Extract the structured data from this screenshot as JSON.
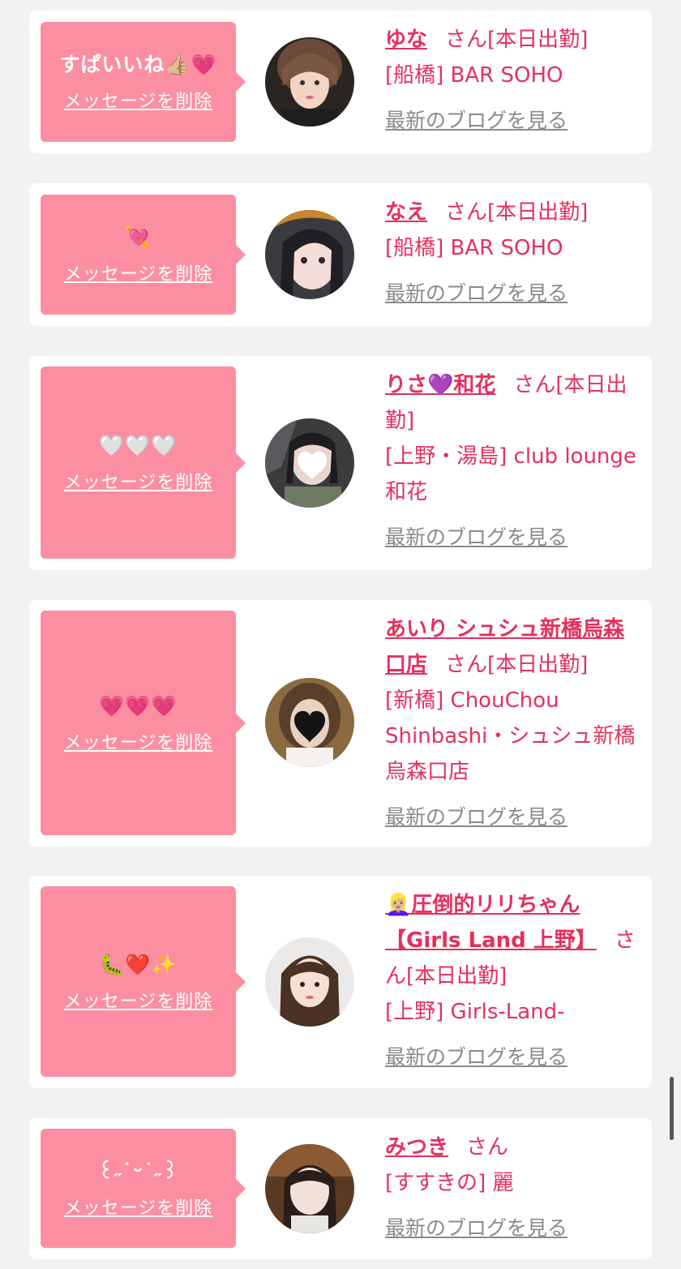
{
  "cards": [
    {
      "message": "すぱいいね👍🏼💗",
      "delete_label": "メッセージを削除",
      "name": "ゆな",
      "san": "さん",
      "status": "[本日出勤]",
      "area_shop": "[船橋] BAR SOHO",
      "blog_label": "最新のブログを見る"
    },
    {
      "message": "💘",
      "delete_label": "メッセージを削除",
      "name": "なえ",
      "san": "さん",
      "status": "[本日出勤]",
      "area_shop": "[船橋] BAR SOHO",
      "blog_label": "最新のブログを見る"
    },
    {
      "message": "🤍🤍🤍",
      "delete_label": "メッセージを削除",
      "name": "りさ💜和花",
      "san": "さん",
      "status": "[本日出勤]",
      "area_shop": "[上野・湯島] club lounge 和花",
      "blog_label": "最新のブログを見る"
    },
    {
      "message": "💗💗💗",
      "delete_label": "メッセージを削除",
      "name": "あいり シュシュ新橋烏森口店",
      "san": "さん",
      "status": "[本日出勤]",
      "area_shop": "[新橋] ChouChou Shinbashi・シュシュ新橋烏森口店",
      "blog_label": "最新のブログを見る"
    },
    {
      "message": "🐛❤️✨",
      "delete_label": "メッセージを削除",
      "name": "👱🏼‍♀️圧倒的リリちゃん【Girls Land 上野】",
      "san": "さん",
      "status": "[本日出勤]",
      "area_shop": "[上野] Girls-Land-",
      "blog_label": "最新のブログを見る"
    },
    {
      "message": "꒰˶˙ᵕ˙˶꒱",
      "delete_label": "メッセージを削除",
      "name": "みつき",
      "san": "さん",
      "status": "",
      "area_shop": "[すすきの] 麗",
      "blog_label": "最新のブログを見る"
    }
  ],
  "colors": {
    "page_bg": "#f2f2f2",
    "bubble": "#fb8fa1",
    "accent_text": "#e5305d",
    "link_gray": "#8a8a8a"
  },
  "icons": [
    "avatar-image",
    "heart-sticker-icon"
  ]
}
